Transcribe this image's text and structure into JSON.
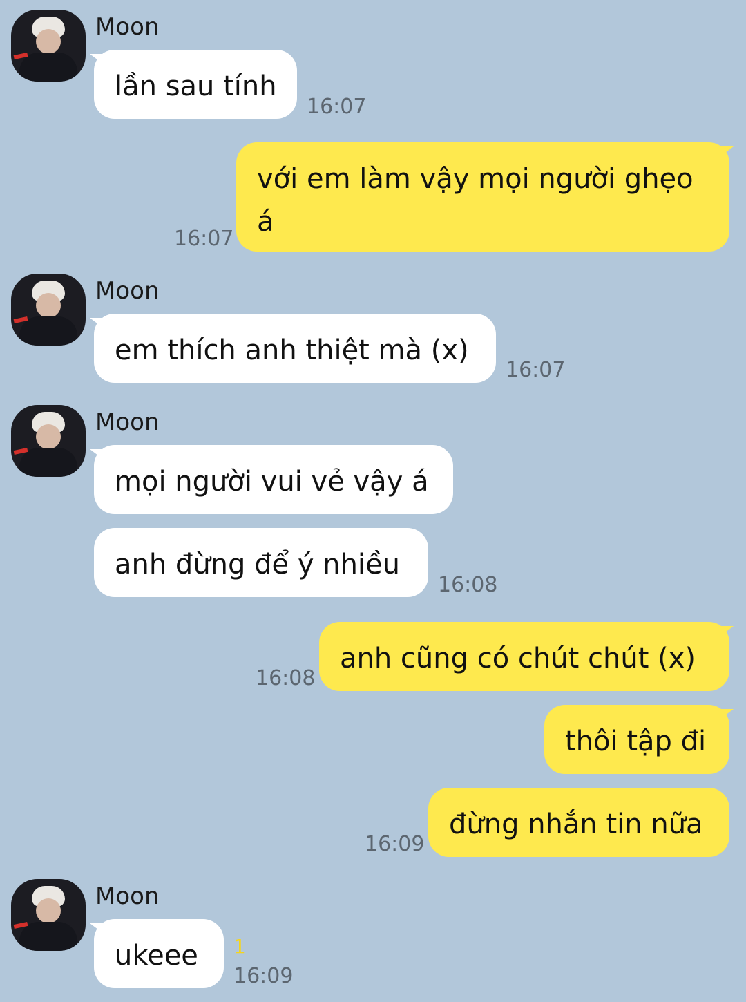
{
  "colors": {
    "background": "#b2c7da",
    "incoming_bubble": "#ffffff",
    "outgoing_bubble": "#fee94e",
    "unread_count": "#f5d51c"
  },
  "messages": [
    {
      "sender": "Moon",
      "text": "lần sau tính",
      "time": "16:07"
    },
    {
      "text": "với em làm vậy mọi người ghẹo á",
      "time": "16:07"
    },
    {
      "sender": "Moon",
      "text": "em thích anh thiệt mà (x)",
      "time": "16:07"
    },
    {
      "sender": "Moon",
      "text": "mọi người vui vẻ vậy á"
    },
    {
      "text": "anh đừng để ý nhiều",
      "time": "16:08"
    },
    {
      "text": "anh cũng có chút chút (x)",
      "time": "16:08"
    },
    {
      "text": "thôi tập đi"
    },
    {
      "text": "đừng nhắn tin nữa",
      "time": "16:09"
    },
    {
      "sender": "Moon",
      "text": "ukeee",
      "time": "16:09",
      "unread": "1"
    }
  ]
}
